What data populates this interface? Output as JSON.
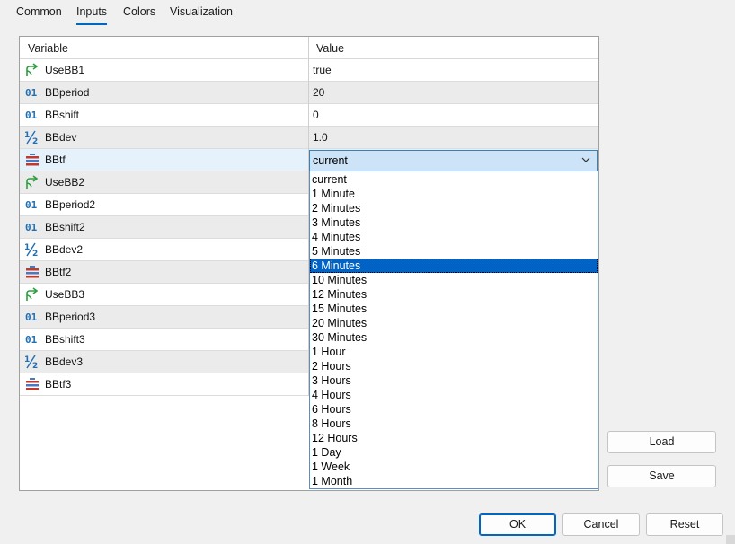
{
  "tabs": [
    {
      "label": "Common"
    },
    {
      "label": "Inputs"
    },
    {
      "label": "Colors"
    },
    {
      "label": "Visualization"
    }
  ],
  "active_tab": "Inputs",
  "table": {
    "headers": {
      "variable": "Variable",
      "value": "Value"
    },
    "rows": [
      {
        "icon": "bool-arrow-icon",
        "name": "UseBB1",
        "value": "true"
      },
      {
        "icon": "integer-icon",
        "name": "BBperiod",
        "value": "20"
      },
      {
        "icon": "integer-icon",
        "name": "BBshift",
        "value": "0"
      },
      {
        "icon": "fraction-icon",
        "name": "BBdev",
        "value": "1.0"
      },
      {
        "icon": "enum-icon",
        "name": "BBtf",
        "value": "current"
      },
      {
        "icon": "bool-arrow-icon",
        "name": "UseBB2",
        "value": ""
      },
      {
        "icon": "integer-icon",
        "name": "BBperiod2",
        "value": ""
      },
      {
        "icon": "integer-icon",
        "name": "BBshift2",
        "value": ""
      },
      {
        "icon": "fraction-icon",
        "name": "BBdev2",
        "value": ""
      },
      {
        "icon": "enum-icon",
        "name": "BBtf2",
        "value": ""
      },
      {
        "icon": "bool-arrow-icon",
        "name": "UseBB3",
        "value": ""
      },
      {
        "icon": "integer-icon",
        "name": "BBperiod3",
        "value": ""
      },
      {
        "icon": "integer-icon",
        "name": "BBshift3",
        "value": ""
      },
      {
        "icon": "fraction-icon",
        "name": "BBdev3",
        "value": ""
      },
      {
        "icon": "enum-icon",
        "name": "BBtf3",
        "value": ""
      }
    ]
  },
  "combo": {
    "value": "current"
  },
  "dropdown": {
    "highlighted": "6 Minutes",
    "options": [
      "current",
      "1 Minute",
      "2 Minutes",
      "3 Minutes",
      "4 Minutes",
      "5 Minutes",
      "6 Minutes",
      "10 Minutes",
      "12 Minutes",
      "15 Minutes",
      "20 Minutes",
      "30 Minutes",
      "1 Hour",
      "2 Hours",
      "3 Hours",
      "4 Hours",
      "6 Hours",
      "8 Hours",
      "12 Hours",
      "1 Day",
      "1 Week",
      "1 Month"
    ]
  },
  "buttons": {
    "load": "Load",
    "save": "Save",
    "ok": "OK",
    "cancel": "Cancel",
    "reset": "Reset"
  },
  "colors": {
    "accent": "#0067c0",
    "highlight": "#0063c5",
    "selected_row": "#e5f1fb",
    "bool_icon": "#2e9e3e",
    "int_icon": "#1f6fb5",
    "enum_icon": "#c0392b"
  }
}
